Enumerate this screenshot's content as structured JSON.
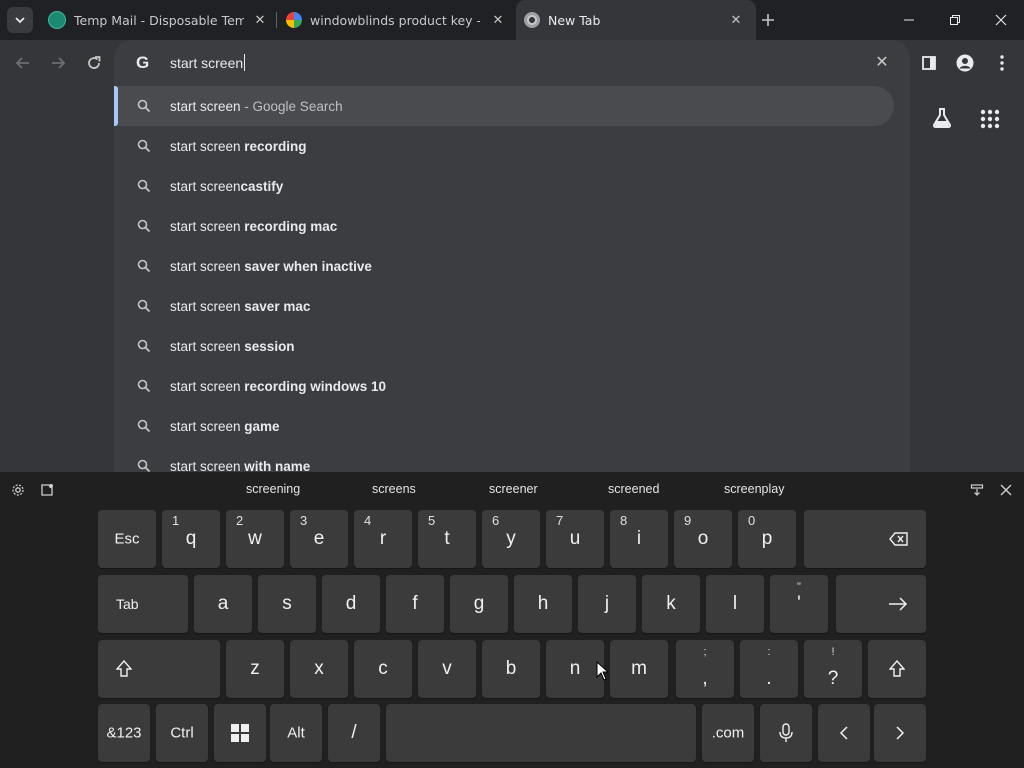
{
  "tabs": [
    {
      "title": "Temp Mail - Disposable Tempor",
      "favicon": "tempmail-icon",
      "active": false
    },
    {
      "title": "windowblinds product key - Go",
      "favicon": "google-icon",
      "active": false
    },
    {
      "title": "New Tab",
      "favicon": "chrome-icon",
      "active": true
    }
  ],
  "omnibox": {
    "text": "start screen"
  },
  "suggestions": [
    {
      "prefix": "start screen",
      "bold": "",
      "suffix": " - Google Search"
    },
    {
      "prefix": "start screen ",
      "bold": "recording",
      "suffix": ""
    },
    {
      "prefix": "start screen",
      "bold": "castify",
      "suffix": ""
    },
    {
      "prefix": "start screen ",
      "bold": "recording mac",
      "suffix": ""
    },
    {
      "prefix": "start screen ",
      "bold": "saver when inactive",
      "suffix": ""
    },
    {
      "prefix": "start screen ",
      "bold": "saver mac",
      "suffix": ""
    },
    {
      "prefix": "start screen ",
      "bold": "session",
      "suffix": ""
    },
    {
      "prefix": "start screen ",
      "bold": "recording windows 10",
      "suffix": ""
    },
    {
      "prefix": "start screen ",
      "bold": "game",
      "suffix": ""
    },
    {
      "prefix": "start screen ",
      "bold": "with name",
      "suffix": ""
    }
  ],
  "keyboard": {
    "candidates": [
      "screening",
      "screens",
      "screener",
      "screened",
      "screenplay"
    ],
    "row1": {
      "esc": "Esc",
      "keys": [
        {
          "num": "1",
          "char": "q"
        },
        {
          "num": "2",
          "char": "w"
        },
        {
          "num": "3",
          "char": "e"
        },
        {
          "num": "4",
          "char": "r"
        },
        {
          "num": "5",
          "char": "t"
        },
        {
          "num": "6",
          "char": "y"
        },
        {
          "num": "7",
          "char": "u"
        },
        {
          "num": "8",
          "char": "i"
        },
        {
          "num": "9",
          "char": "o"
        },
        {
          "num": "0",
          "char": "p"
        }
      ]
    },
    "row2": {
      "tab": "Tab",
      "keys": [
        "a",
        "s",
        "d",
        "f",
        "g",
        "h",
        "j",
        "k",
        "l"
      ],
      "quote_top": "\"",
      "quote_main": "'"
    },
    "row3": {
      "keys": [
        "z",
        "x",
        "c",
        "v",
        "b",
        "n",
        "m"
      ],
      "comma_top": ";",
      "comma_main": ",",
      "period_top": ":",
      "period_main": ".",
      "question_top": "!",
      "question_main": "?"
    },
    "row4": {
      "symbols": "&123",
      "ctrl": "Ctrl",
      "alt": "Alt",
      "slash": "/",
      "dotcom": ".com"
    }
  },
  "colors": {
    "accent": "#a8c7fa",
    "tabstrip": "#202124",
    "page": "#35363a",
    "keyboard": "#202020",
    "key": "#3b3b3b"
  }
}
